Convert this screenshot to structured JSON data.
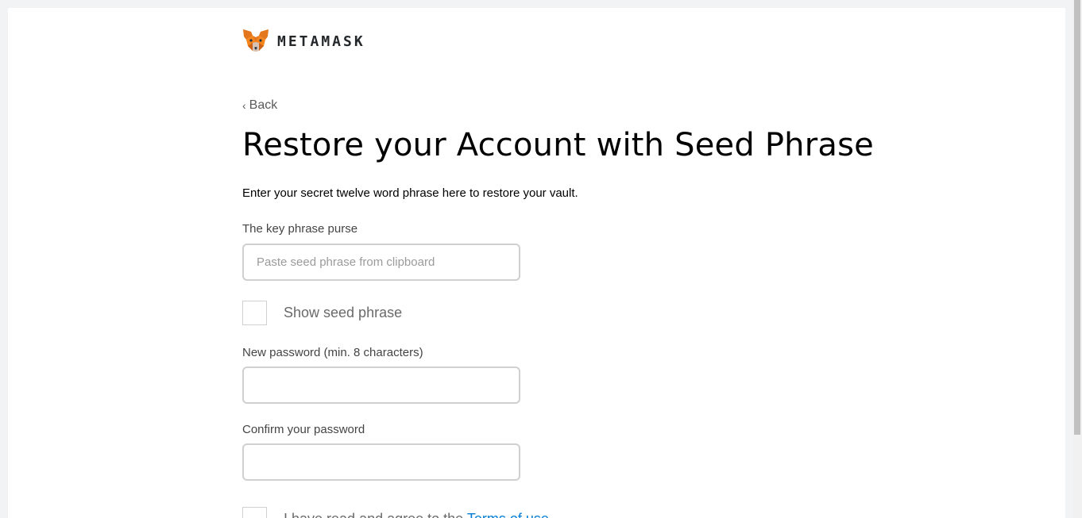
{
  "brand": {
    "name": "METAMASK",
    "logo_icon": "fox-icon"
  },
  "nav": {
    "back_label": "Back",
    "back_icon": "chevron-left-icon",
    "back_glyph": "‹"
  },
  "page": {
    "title": "Restore your Account with Seed Phrase",
    "subtitle": "Enter your secret twelve word phrase here to restore your vault."
  },
  "form": {
    "seed": {
      "label": "The key phrase purse",
      "placeholder": "Paste seed phrase from clipboard",
      "value": ""
    },
    "show_seed": {
      "label": "Show seed phrase",
      "checked": false
    },
    "password": {
      "label": "New password (min. 8 characters)",
      "value": ""
    },
    "confirm": {
      "label": "Confirm your password",
      "value": ""
    },
    "terms": {
      "text": "I have read and agree to the ",
      "link": "Terms of use",
      "checked": false
    }
  },
  "colors": {
    "link": "#037dd6",
    "border": "#d0d0d0",
    "fox_orange": "#e2761b"
  }
}
